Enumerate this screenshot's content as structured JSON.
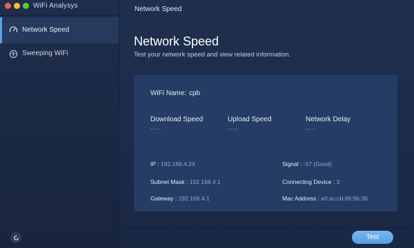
{
  "app": {
    "title": "WiFi Analysys"
  },
  "sidebar": {
    "items": [
      {
        "label": "Network Speed",
        "icon": "speedometer-icon",
        "active": true
      },
      {
        "label": "Sweeping WiFi",
        "icon": "wifi-sweep-icon",
        "active": false
      }
    ],
    "footer_icon": "refresh-icon"
  },
  "header": {
    "title": "Network Speed"
  },
  "main": {
    "title": "Network Speed",
    "subtitle": "Test your network speed and view related information.",
    "wifi_name_label": "WiFi Name:",
    "wifi_name_value": "cpb",
    "metrics": [
      {
        "label": "Download Speed",
        "value": "----"
      },
      {
        "label": "Upload Speed",
        "value": "----"
      },
      {
        "label": "Network Delay",
        "value": "----"
      }
    ],
    "info": {
      "ip_label": "IP :",
      "ip_value": "192.168.4.24",
      "mask_label": "Subnet Mask :",
      "mask_value": "192.168.4.1",
      "gateway_label": "Gateway :",
      "gateway_value": "192.168.4.1",
      "signal_label": "Signal :",
      "signal_value": "-57 (Good)",
      "devices_label": "Connecting Device :",
      "devices_value": "3",
      "mac_label": "Mac Address :",
      "mac_value": "e0:ac:cb:86:9b:36"
    },
    "test_button": "Test"
  },
  "colors": {
    "accent": "#5aa0e6",
    "value_blue": "#7eb0ea",
    "card": "#253c65",
    "background": "#1f2f4e"
  }
}
